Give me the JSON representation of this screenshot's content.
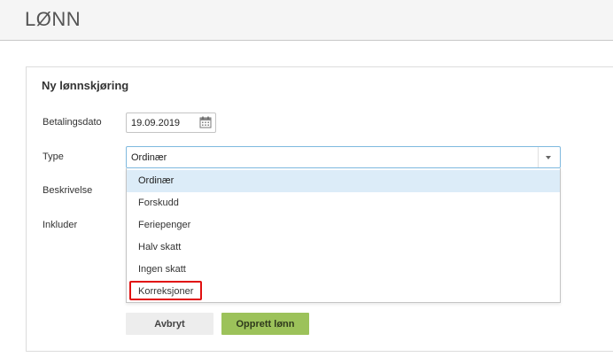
{
  "header": {
    "app_title": "LØNN"
  },
  "form": {
    "title": "Ny lønnskjøring",
    "labels": {
      "payment_date": "Betalingsdato",
      "type": "Type",
      "description": "Beskrivelse",
      "include": "Inkluder"
    },
    "payment_date_value": "19.09.2019",
    "type_selected": "Ordinær",
    "type_options": [
      "Ordinær",
      "Forskudd",
      "Feriepenger",
      "Halv skatt",
      "Ingen skatt",
      "Korreksjoner"
    ],
    "highlighted_option": "Korreksjoner"
  },
  "actions": {
    "cancel_label": "Avbryt",
    "create_label": "Opprett lønn"
  },
  "icons": {
    "date_picker": "calendar-icon",
    "select_toggle": "chevron-down-icon"
  },
  "colors": {
    "create_button": "#9cc25a",
    "selected_option_bg": "#dcecf8",
    "focus_border": "#7fb9de",
    "highlight_border": "#e11010"
  }
}
